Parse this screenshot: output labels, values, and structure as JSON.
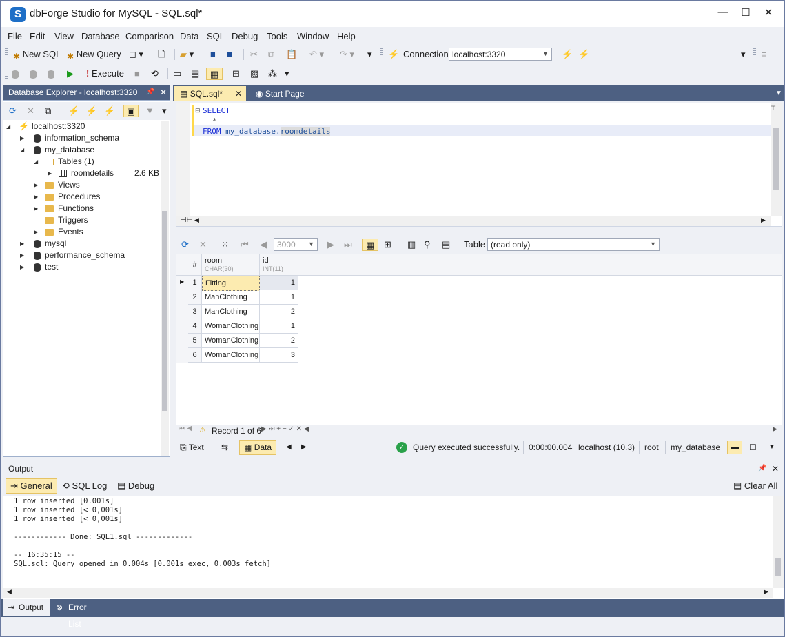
{
  "app": {
    "icon_letter": "S",
    "title": "dbForge Studio for MySQL - SQL.sql*",
    "icon": "dbforge-logo-icon"
  },
  "window_controls": {
    "minimize": "—",
    "maximize": "☐",
    "close": "✕"
  },
  "menu": [
    "File",
    "Edit",
    "View",
    "Database",
    "Comparison",
    "Data",
    "SQL",
    "Debug",
    "Tools",
    "Window",
    "Help"
  ],
  "toolbar1": {
    "new_sql": "New SQL",
    "new_query": "New Query",
    "connection_label": "Connection",
    "connection_value": "localhost:3320"
  },
  "toolbar2": {
    "execute": "Execute"
  },
  "explorer": {
    "title": "Database Explorer - localhost:3320",
    "tree": [
      {
        "label": "localhost:3320",
        "level": 0,
        "type": "server",
        "expanded": true
      },
      {
        "label": "information_schema",
        "level": 1,
        "type": "db",
        "expanded": false
      },
      {
        "label": "my_database",
        "level": 1,
        "type": "db",
        "expanded": true
      },
      {
        "label": "Tables (1)",
        "level": 2,
        "type": "folder",
        "expanded": true
      },
      {
        "label": "roomdetails",
        "level": 3,
        "type": "table",
        "expanded": false,
        "size": "2.6 KB"
      },
      {
        "label": "Views",
        "level": 2,
        "type": "folder",
        "expanded": false
      },
      {
        "label": "Procedures",
        "level": 2,
        "type": "folder",
        "expanded": false
      },
      {
        "label": "Functions",
        "level": 2,
        "type": "folder",
        "expanded": false
      },
      {
        "label": "Triggers",
        "level": 2,
        "type": "folder",
        "expanded": null
      },
      {
        "label": "Events",
        "level": 2,
        "type": "folder",
        "expanded": false
      },
      {
        "label": "mysql",
        "level": 1,
        "type": "db",
        "expanded": false
      },
      {
        "label": "performance_schema",
        "level": 1,
        "type": "db",
        "expanded": false
      },
      {
        "label": "test",
        "level": 1,
        "type": "db",
        "expanded": false
      }
    ]
  },
  "tabs": [
    {
      "label": "SQL.sql*",
      "active": true
    },
    {
      "label": "Start Page",
      "active": false
    }
  ],
  "editor": {
    "line1": "SELECT",
    "line2": "*",
    "line3_kw": "FROM",
    "line3_db": "my_database.",
    "line3_tbl": "roomdetails"
  },
  "grid_toolbar": {
    "page_size": "3000",
    "table_label": "Table",
    "table_value": "(read only)"
  },
  "grid": {
    "row_header": "#",
    "columns": [
      {
        "name": "room",
        "type": "CHAR(30)"
      },
      {
        "name": "id",
        "type": "INT(11)"
      }
    ],
    "rows": [
      {
        "n": "1",
        "room": "Fitting",
        "id": "1"
      },
      {
        "n": "2",
        "room": "ManClothing",
        "id": "1"
      },
      {
        "n": "3",
        "room": "ManClothing",
        "id": "2"
      },
      {
        "n": "4",
        "room": "WomanClothing",
        "id": "1"
      },
      {
        "n": "5",
        "room": "WomanClothing",
        "id": "2"
      },
      {
        "n": "6",
        "room": "WomanClothing",
        "id": "3"
      }
    ]
  },
  "record_nav": {
    "text": "Record 1 of 6"
  },
  "status": {
    "text_tab": "Text",
    "data_tab": "Data",
    "message": "Query executed successfully.",
    "time": "0:00:00.004",
    "server": "localhost (10.3)",
    "user": "root",
    "database": "my_database"
  },
  "output": {
    "title": "Output",
    "tabs": {
      "general": "General",
      "sql_log": "SQL Log",
      "debug": "Debug",
      "clear_all": "Clear All"
    },
    "lines": [
      "1 row inserted [0.001s]",
      "1 row inserted [< 0,001s]",
      "1 row inserted [< 0,001s]",
      "",
      "------------ Done: SQL1.sql -------------",
      "",
      "-- 16:35:15 --",
      "SQL.sql: Query opened in 0.004s [0.001s exec, 0.003s fetch]"
    ]
  },
  "bottom_tabs": {
    "output": "Output",
    "error_list": "Error List"
  }
}
